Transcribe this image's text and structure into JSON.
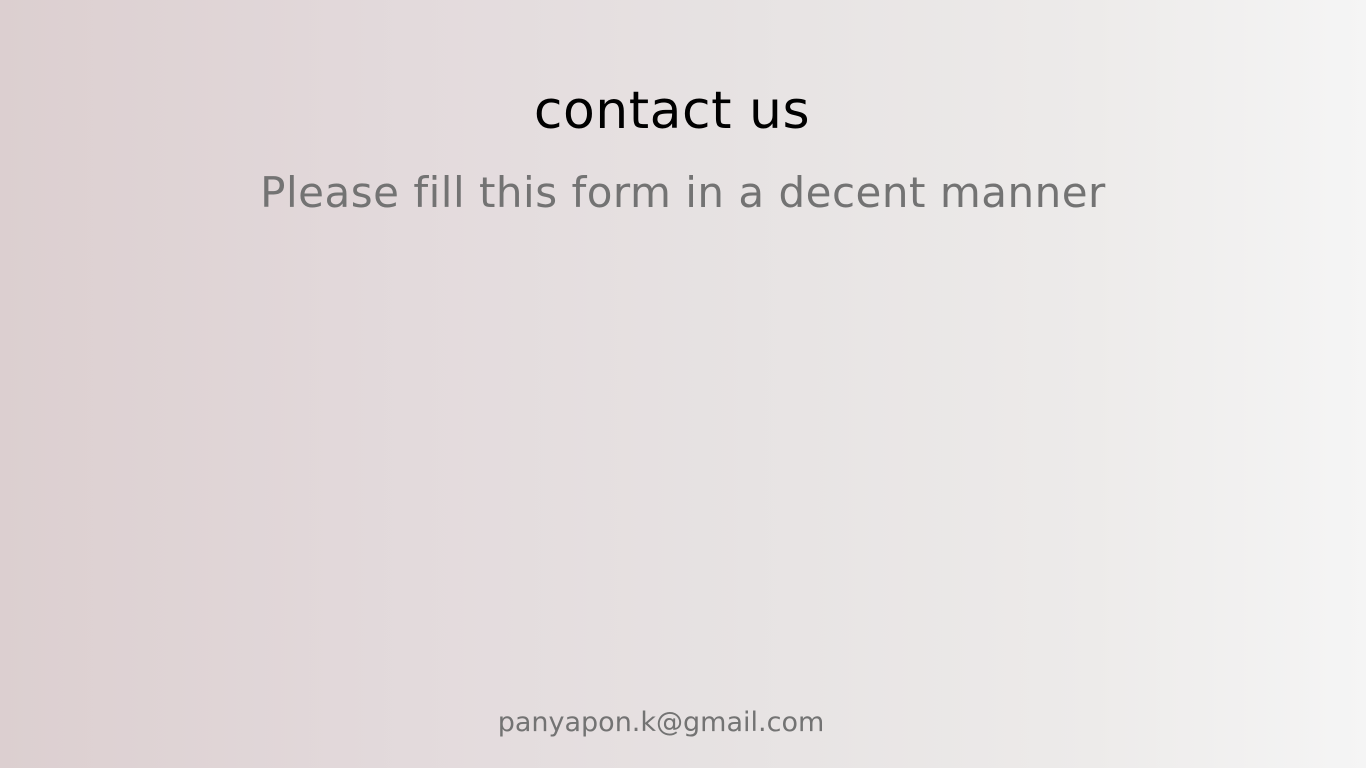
{
  "header": {
    "title": "contact us",
    "subtitle": "Please fill this form in a decent manner"
  },
  "footer": {
    "email": "panyapon.k@gmail.com"
  },
  "colors": {
    "title": "#000000",
    "subtitle": "#737373",
    "footer": "#737373",
    "background_left": "#dccfd0",
    "background_right": "#f5f5f5"
  }
}
